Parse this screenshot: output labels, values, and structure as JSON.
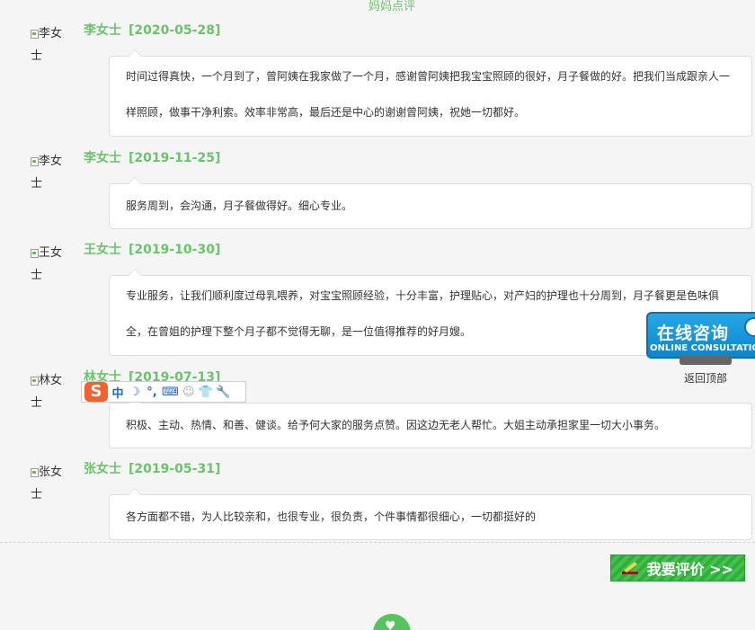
{
  "header": {
    "title": "妈妈点评"
  },
  "reviews": [
    {
      "avatar_alt": "李女士",
      "name": "李女士",
      "date": "[2020-05-28]",
      "text": "时间过得真快，一个月到了，曾阿姨在我家做了一个月，感谢曾阿姨把我宝宝照顾的很好，月子餐做的好。把我们当成跟亲人一样照顾，做事干净利索。效率非常高，最后还是中心的谢谢曾阿姨，祝她一切都好。"
    },
    {
      "avatar_alt": "李女士",
      "name": "李女士",
      "date": "[2019-11-25]",
      "text": "服务周到，会沟通，月子餐做得好。细心专业。"
    },
    {
      "avatar_alt": "王女士",
      "name": "王女士",
      "date": "[2019-10-30]",
      "text": "专业服务，让我们顺利度过母乳喂养，对宝宝照顾经验，十分丰富，护理贴心，对产妇的护理也十分周到，月子餐更是色味俱全，在曾姐的护理下整个月子都不觉得无聊，是一位值得推荐的好月嫂。"
    },
    {
      "avatar_alt": "林女士",
      "name": "林女士",
      "date": "[2019-07-13]",
      "text": "积极、主动、热情、和善、健谈。给予何大家的服务点赞。因这边无老人帮忙。大姐主动承担家里一切大小事务。"
    },
    {
      "avatar_alt": "张女士",
      "name": "张女士",
      "date": "[2019-05-31]",
      "text": "各方面都不错，为人比较亲和，也很专业，很负责，个件事情都很细心，一切都挺好的"
    }
  ],
  "actions": {
    "write_review": "我要评价 >>"
  },
  "float": {
    "online_cn": "在线咨询",
    "online_en": "ONLINE CONSULTATION",
    "back_to_top": "返回顶部"
  },
  "ime": {
    "logo": "S",
    "mode": "中",
    "moon": "☽",
    "punct": "°,",
    "keyboard": "⌨",
    "user": "☺",
    "skin": "👕",
    "tool": "🔧"
  }
}
